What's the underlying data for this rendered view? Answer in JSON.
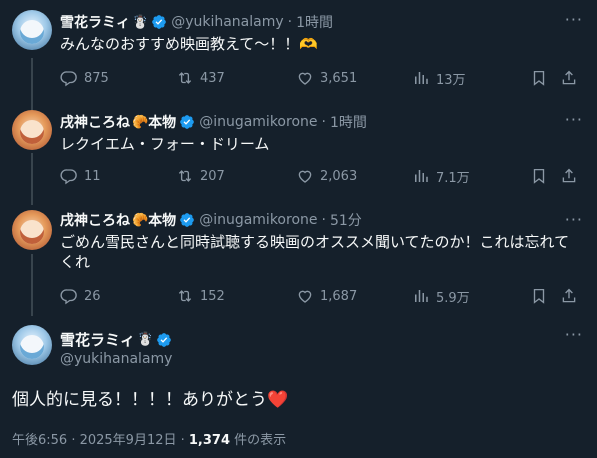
{
  "tweets": [
    {
      "name": "雪花ラミィ",
      "emoji": "☃️",
      "handle": "@yukihanalamy",
      "dot": "·",
      "time": "1時間",
      "text": "みんなのおすすめ映画教えて〜！！🫶",
      "replies": "875",
      "retweets": "437",
      "likes": "3,651",
      "views": "13万"
    },
    {
      "name": "戌神ころね",
      "emoji": "🥐",
      "badge": "本物",
      "handle": "@inugamikorone",
      "dot": "·",
      "time": "1時間",
      "text": "レクイエム・フォー・ドリーム",
      "replies": "11",
      "retweets": "207",
      "likes": "2,063",
      "views": "7.1万"
    },
    {
      "name": "戌神ころね",
      "emoji": "🥐",
      "badge": "本物",
      "handle": "@inugamikorone",
      "dot": "·",
      "time": "51分",
      "text": "ごめん雪民さんと同時試聴する映画のオススメ聞いてたのか！これは忘れてくれ",
      "replies": "26",
      "retweets": "152",
      "likes": "1,687",
      "views": "5.9万"
    }
  ],
  "main": {
    "name": "雪花ラミィ",
    "emoji": "☃️",
    "handle": "@yukihanalamy",
    "text": "個人的に見る！！！！ありがとう",
    "heart": "❤️",
    "meta_time": "午後6:56 · 2025年9月12日 · ",
    "meta_views": "1,374",
    "meta_suffix": " 件の表示"
  },
  "icons": {
    "verified": "verified-badge-icon",
    "more": "more-options-icon",
    "reply": "reply-icon",
    "retweet": "retweet-icon",
    "like": "like-icon",
    "views": "views-icon",
    "bookmark": "bookmark-icon",
    "share": "share-icon"
  },
  "colors": {
    "background": "#15202b",
    "verified": "#1d9bf0",
    "muted": "#8b98a5",
    "text": "#f7f9f9"
  }
}
